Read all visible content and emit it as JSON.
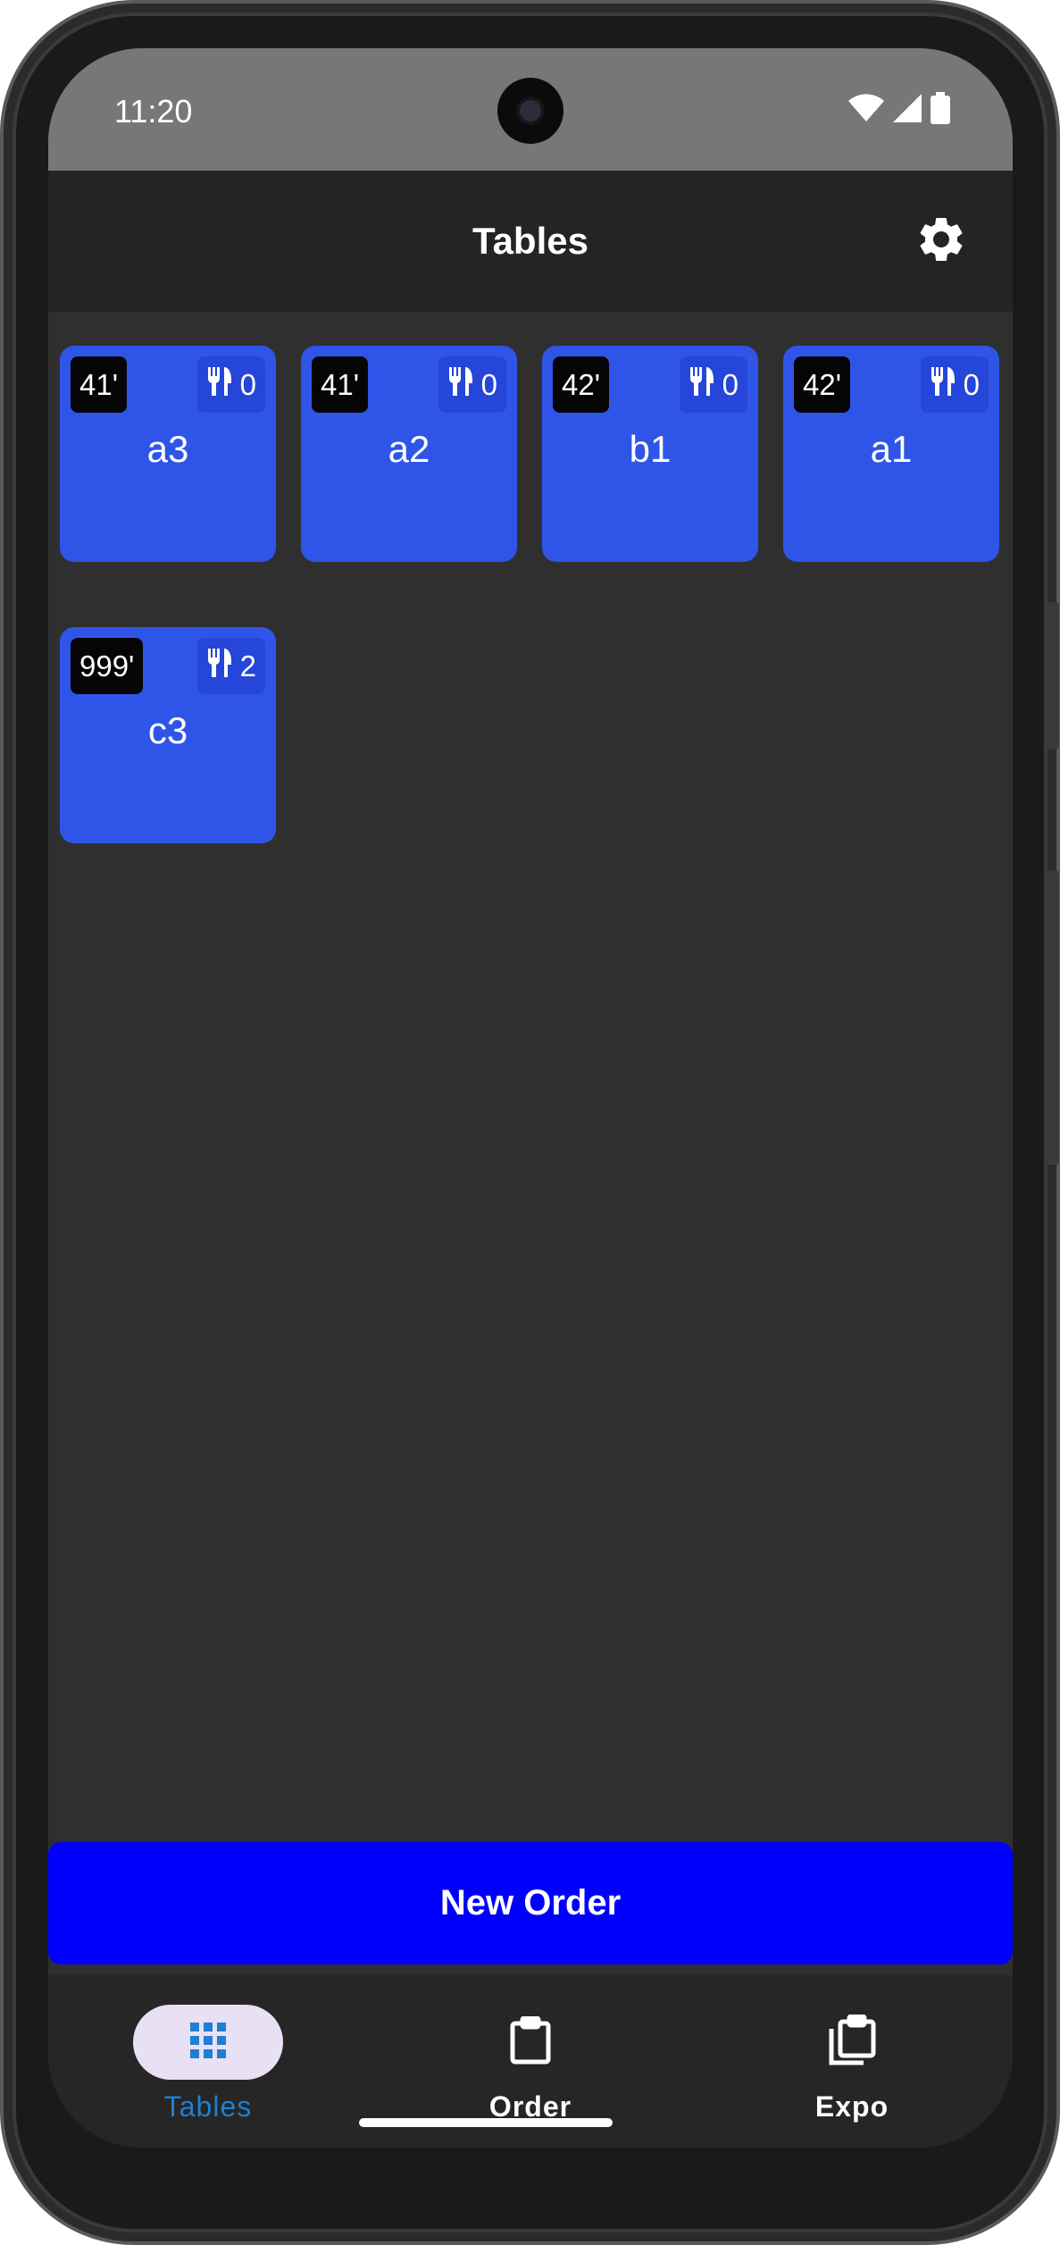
{
  "status_bar": {
    "time": "11:20"
  },
  "app_bar": {
    "title": "Tables",
    "settings_icon": "gear-icon"
  },
  "tables": [
    {
      "time": "41'",
      "guests": "0",
      "name": "a3"
    },
    {
      "time": "41'",
      "guests": "0",
      "name": "a2"
    },
    {
      "time": "42'",
      "guests": "0",
      "name": "b1"
    },
    {
      "time": "42'",
      "guests": "0",
      "name": "a1"
    },
    {
      "time": "999'",
      "guests": "2",
      "name": "c3"
    }
  ],
  "new_order": {
    "label": "New Order"
  },
  "bottom_nav": {
    "tables_label": "Tables",
    "order_label": "Order",
    "expo_label": "Expo",
    "active": "Tables"
  },
  "colors": {
    "card": "#2f55e8",
    "new_order": "#0000fe",
    "active_nav": "#1f7fd0"
  }
}
